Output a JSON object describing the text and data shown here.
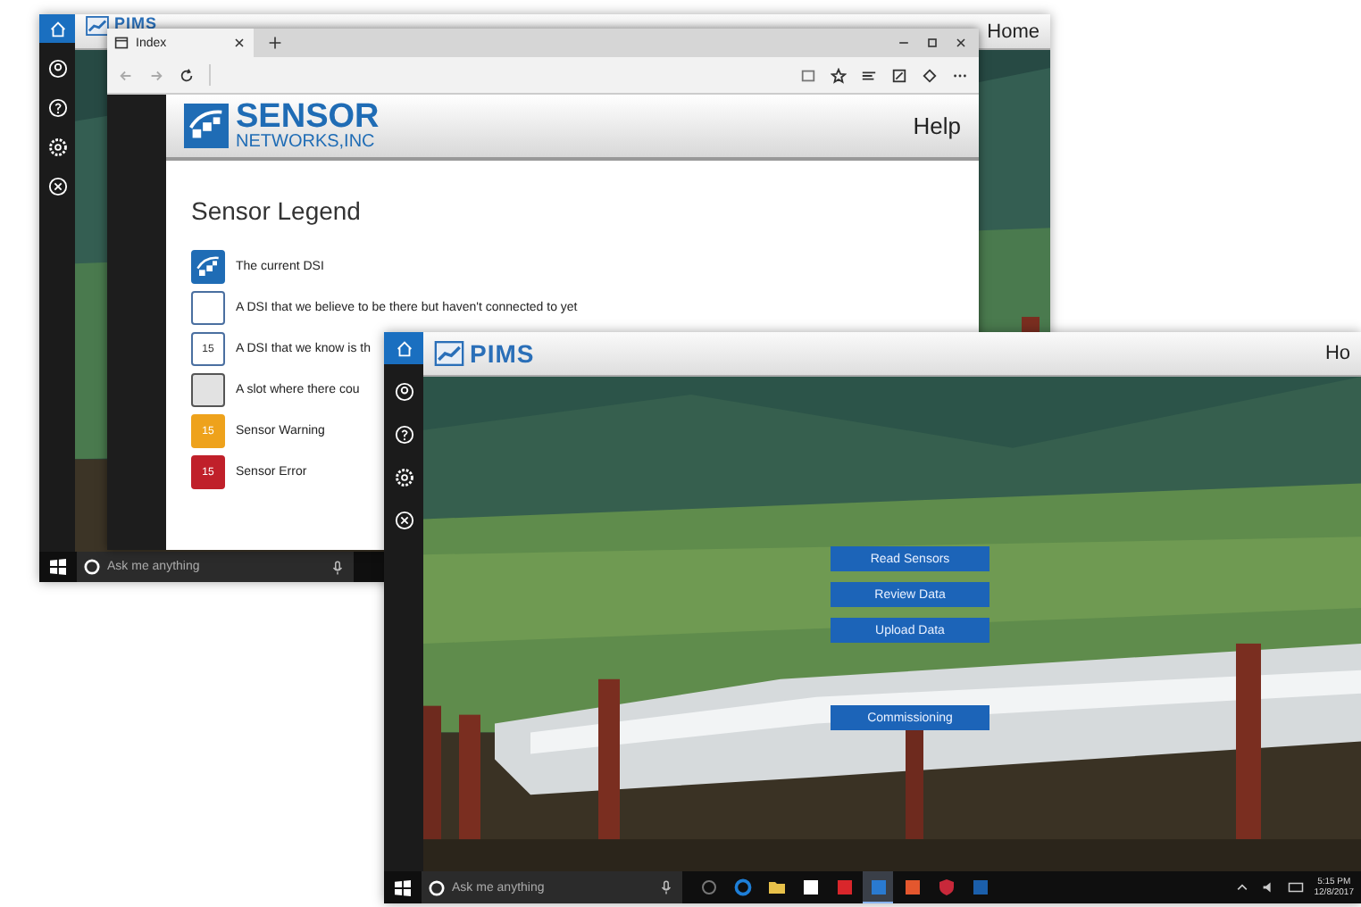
{
  "back_screen": {
    "sidebar": [
      {
        "kind": "home",
        "selected": true
      },
      {
        "kind": "account",
        "selected": false
      },
      {
        "kind": "help",
        "selected": false
      },
      {
        "kind": "settings",
        "selected": false
      },
      {
        "kind": "exit",
        "selected": false
      }
    ],
    "header": {
      "logo": "PIMS",
      "link": "Home"
    },
    "browser": {
      "tab": "Index",
      "page_title": "Help",
      "logo_line1": "SENSOR",
      "logo_line2": "NETWORKS,INC",
      "heading": "Sensor Legend",
      "legend": [
        {
          "kind": "current",
          "label": "The current DSI"
        },
        {
          "kind": "empty",
          "label": "A DSI that we believe to be there but haven't connected to yet"
        },
        {
          "kind": "known",
          "badge": "15",
          "label": "A DSI that we know is th"
        },
        {
          "kind": "slot",
          "label": "A slot where there cou"
        },
        {
          "kind": "warning",
          "badge": "15",
          "label": "Sensor Warning"
        },
        {
          "kind": "error",
          "badge": "15",
          "label": "Sensor Error"
        }
      ]
    },
    "taskbar": {
      "search_placeholder": "Ask me anything"
    }
  },
  "front_screen": {
    "sidebar": [
      {
        "kind": "home",
        "selected": true
      },
      {
        "kind": "account",
        "selected": false
      },
      {
        "kind": "help",
        "selected": false
      },
      {
        "kind": "settings",
        "selected": false
      },
      {
        "kind": "exit",
        "selected": false
      }
    ],
    "header": {
      "logo": "PIMS",
      "link": "Ho"
    },
    "buttons": [
      {
        "label": "Read Sensors",
        "kind": "main"
      },
      {
        "label": "Review Data",
        "kind": "main"
      },
      {
        "label": "Upload Data",
        "kind": "main"
      },
      {
        "label": "Commissioning",
        "kind": "separate"
      }
    ],
    "taskbar": {
      "search_placeholder": "Ask me anything",
      "apps": [
        {
          "kind": "taskview",
          "active": false
        },
        {
          "kind": "edge",
          "active": false
        },
        {
          "kind": "folder",
          "active": false
        },
        {
          "kind": "store",
          "active": false
        },
        {
          "kind": "mail",
          "active": false
        },
        {
          "kind": "pims",
          "active": true
        },
        {
          "kind": "office",
          "active": false
        },
        {
          "kind": "shield",
          "active": false
        },
        {
          "kind": "outlook",
          "active": false
        }
      ],
      "time": "5:15 PM",
      "date": "12/8/2017"
    }
  }
}
